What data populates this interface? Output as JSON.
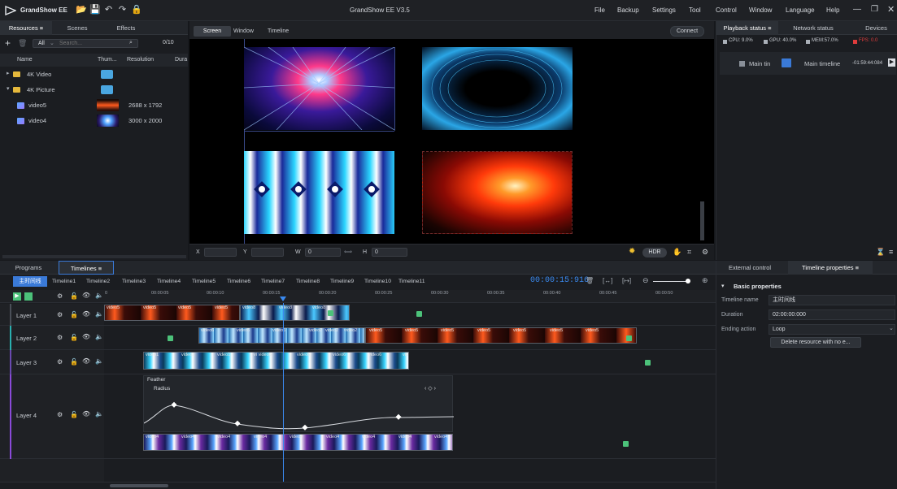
{
  "titlebar": {
    "app_name": "GrandShow EE",
    "center_title": "GrandShow EE V3.5",
    "menu": [
      "File",
      "Backup",
      "Settings",
      "Tool",
      "Control",
      "Window",
      "Language",
      "Help"
    ],
    "icons": [
      "folder-open-icon",
      "save-icon",
      "undo-icon",
      "redo-icon",
      "lock-icon"
    ]
  },
  "resources": {
    "tabs": [
      "Resources ≡",
      "Scenes",
      "Effects"
    ],
    "filter_value": "All",
    "search_placeholder": "Search...",
    "count": "0/10",
    "columns": [
      "Name",
      "Thum...",
      "Resolution",
      "Dura"
    ],
    "rows": [
      {
        "name": "4K Video",
        "type": "folder",
        "resolution": ""
      },
      {
        "name": "4K Picture",
        "type": "folder",
        "resolution": ""
      },
      {
        "name": "video5",
        "type": "video",
        "resolution": "2688 x 1792"
      },
      {
        "name": "video4",
        "type": "video",
        "resolution": "3000 x 2000"
      }
    ]
  },
  "preview": {
    "tabs": [
      "Screen",
      "Window",
      "Timeline"
    ],
    "connect_label": "Connect",
    "coords": {
      "x_label": "X",
      "y_label": "Y",
      "w_label": "W",
      "w_value": "0",
      "h_label": "H",
      "h_value": "0"
    },
    "hdr_label": "HDR"
  },
  "playback": {
    "tabs": [
      "Playback status ≡",
      "Network status",
      "Devices"
    ],
    "stats": [
      {
        "label": "CPU: 9.0%",
        "color": "#c8ccd2"
      },
      {
        "label": "GPU: 40.0%",
        "color": "#c8ccd2"
      },
      {
        "label": "MEM:57.0%",
        "color": "#c8ccd2"
      },
      {
        "label": "FPS: 0.0",
        "color": "#e03c3c"
      }
    ],
    "main_label": "Main tin",
    "timeline_name": "Main timeline",
    "time": "-01:59:44:084"
  },
  "bottom_tabs": [
    "Programs",
    "Timelines ≡"
  ],
  "timeline": {
    "tabs": [
      "主时间线",
      "Timeline1",
      "Timeline2",
      "Timeline3",
      "Timeline4",
      "Timeline5",
      "Timeline6",
      "Timeline7",
      "Timeline8",
      "Timeline9",
      "Timeline10",
      "Timeline11"
    ],
    "current_time": "00:00:15:916",
    "ruler": [
      "0",
      "00:00:05",
      "00:00:10",
      "00:00:15",
      "00:00:20",
      "00:00:25",
      "00:00:30",
      "00:00:35",
      "00:00:40",
      "00:00:45",
      "00:00:50"
    ],
    "layers": [
      "Layer 1",
      "Layer 2",
      "Layer 3",
      "Layer 4"
    ],
    "clips": {
      "layer1": [
        "video5",
        "video5",
        "video5",
        "video5",
        "video8",
        "video8",
        "video8"
      ],
      "layer2": [
        "video6",
        "video6",
        "video6",
        "video2",
        "video2",
        "video2",
        "video5",
        "video5",
        "video5",
        "video5",
        "video5",
        "video5",
        "video5"
      ],
      "layer3": [
        "video1",
        "video1",
        "video1",
        "vi video6",
        "video6",
        "video6",
        "video6",
        "vid"
      ],
      "layer4": [
        "video4",
        "video4",
        "video4",
        "video4",
        "video4",
        "video4",
        "video4",
        "video4",
        "video4"
      ]
    },
    "effect": {
      "group": "Feather",
      "param": "Radius"
    }
  },
  "properties": {
    "tabs": [
      "External control",
      "Timeline properties ≡"
    ],
    "section": "Basic properties",
    "fields": [
      {
        "label": "Timeline name",
        "value": "主时间线"
      },
      {
        "label": "Duration",
        "value": "02:00:00:000"
      },
      {
        "label": "Ending action",
        "value": "Loop"
      }
    ],
    "delete_button": "Delete resource with no e..."
  }
}
